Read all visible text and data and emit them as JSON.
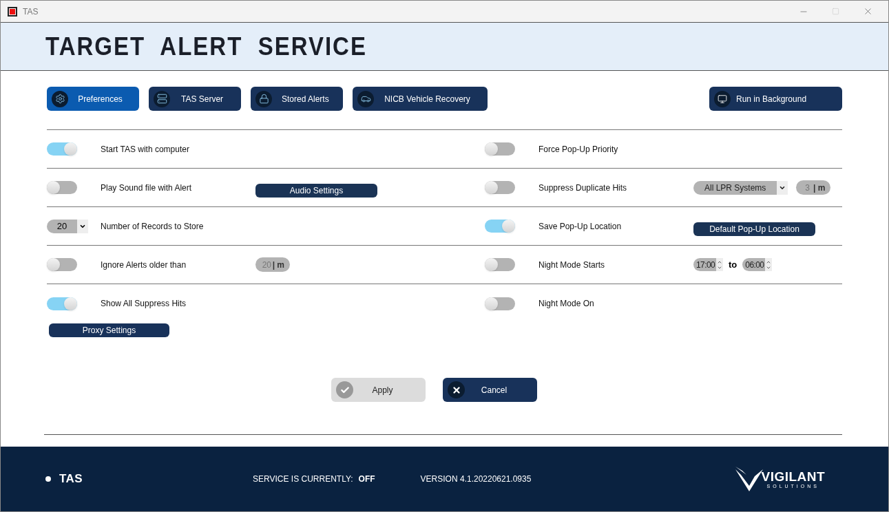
{
  "window": {
    "title": "TAS"
  },
  "header": {
    "title": "TARGET  ALERT  SERVICE"
  },
  "nav": [
    {
      "label": "Preferences",
      "selected": true
    },
    {
      "label": "TAS Server",
      "selected": false
    },
    {
      "label": "Stored Alerts",
      "selected": false
    },
    {
      "label": "NICB Vehicle Recovery",
      "selected": false
    }
  ],
  "run_button": {
    "label": "Run in Background"
  },
  "rows": [
    {
      "left": {
        "kind": "toggle",
        "on": true,
        "label": "Start TAS with computer"
      },
      "right": {
        "kind": "toggle",
        "on": false,
        "label": "Force Pop-Up Priority"
      }
    },
    {
      "left": {
        "kind": "toggle",
        "on": false,
        "label": "Play Sound file with Alert",
        "extras": [
          {
            "kind": "button",
            "label": "Audio Settings"
          }
        ]
      },
      "right": {
        "kind": "toggle",
        "on": false,
        "label": "Suppress Duplicate Hits",
        "extras": [
          {
            "kind": "select",
            "value": "All LPR Systems"
          },
          {
            "kind": "minutes",
            "value": "3",
            "unit": "| m",
            "disabled": true
          }
        ]
      }
    },
    {
      "left": {
        "kind": "select",
        "value": "20",
        "label": "Number of Records to Store"
      },
      "right": {
        "kind": "toggle",
        "on": true,
        "label": "Save Pop-Up Location",
        "extras": [
          {
            "kind": "button",
            "label": "Default Pop-Up Location"
          }
        ]
      }
    },
    {
      "left": {
        "kind": "toggle",
        "on": false,
        "label": "Ignore Alerts older than",
        "extras": [
          {
            "kind": "minutes",
            "value": "20",
            "unit": "| m",
            "disabled": true
          }
        ]
      },
      "right": {
        "kind": "toggle",
        "on": false,
        "label": "Night Mode Starts",
        "extras": [
          {
            "kind": "time_range",
            "from": "17:00",
            "sep": "to",
            "to": "06:00"
          }
        ]
      }
    },
    {
      "left": {
        "kind": "toggle",
        "on": true,
        "label": "Show All Suppress Hits"
      },
      "right": {
        "kind": "toggle",
        "on": false,
        "label": "Night Mode On"
      }
    }
  ],
  "proxy_button": {
    "label": "Proxy Settings"
  },
  "actions": [
    {
      "kind": "apply",
      "label": "Apply",
      "disabled": true
    },
    {
      "kind": "cancel",
      "label": "Cancel",
      "disabled": false
    }
  ],
  "footer": {
    "app": "TAS",
    "service_label": "SERVICE IS CURRENTLY:",
    "service_state": "OFF",
    "version": "VERSION 4.1.20220621.0935",
    "logo_name": "VIGILANT",
    "logo_sub": "SOLUTIONS"
  }
}
